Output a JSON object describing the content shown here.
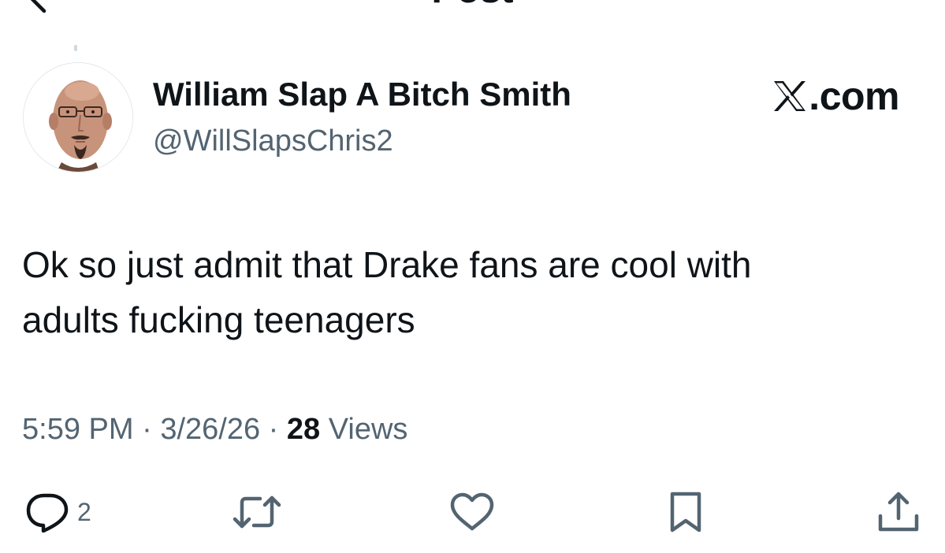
{
  "nav": {
    "title": "Post"
  },
  "author": {
    "display_name": "William Slap A Bitch Smith",
    "handle": "@WillSlapsChris2"
  },
  "brand": {
    "text": ".com"
  },
  "post": {
    "text": "Ok so just admit that Drake fans are cool with\nadults fucking teenagers"
  },
  "meta": {
    "time": "5:59 PM",
    "separator": " · ",
    "date": "3/26/26",
    "views_count": "28",
    "views_label": " Views"
  },
  "actions": {
    "reply_count": "2"
  },
  "icons": {
    "back": "chevron-left-icon",
    "brand": "x-logo-icon",
    "reply": "speech-bubble-icon",
    "repost": "repost-arrows-icon",
    "like": "heart-icon",
    "bookmark": "bookmark-icon",
    "share": "upload-arrow-icon"
  },
  "colors": {
    "text_primary": "#0f1419",
    "text_secondary": "#536471",
    "icon": "#536471",
    "background": "#ffffff"
  }
}
